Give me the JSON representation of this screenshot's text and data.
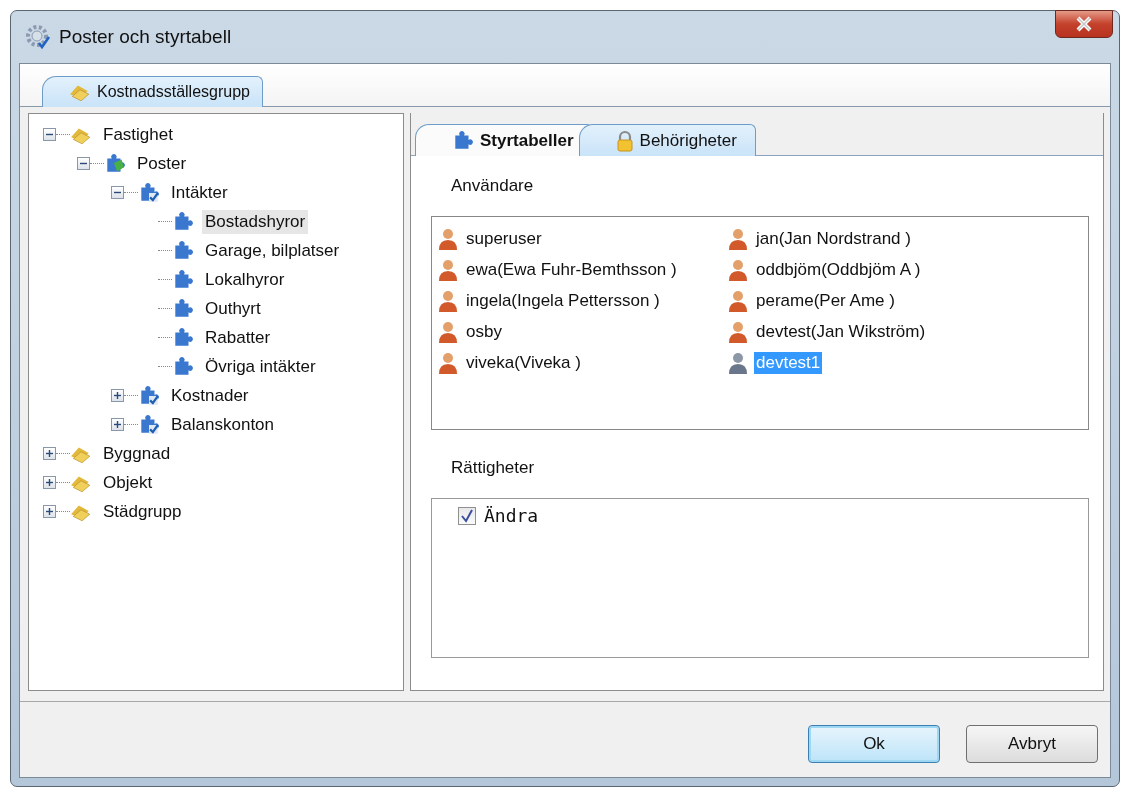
{
  "window": {
    "title": "Poster och styrtabell"
  },
  "outer_tabs": [
    {
      "label": "Kostnadsställesgrupp",
      "selected": true
    }
  ],
  "tree": [
    {
      "label": "Fastighet",
      "kind": "group",
      "expanded": true,
      "selected": false,
      "children": [
        {
          "label": "Poster",
          "kind": "puzzle-green",
          "expanded": true,
          "selected": false,
          "children": [
            {
              "label": "Intäkter",
              "kind": "puzzle-check",
              "expanded": true,
              "selected": false,
              "children": [
                {
                  "label": "Bostadshyror",
                  "kind": "puzzle",
                  "selected": true
                },
                {
                  "label": "Garage, bilplatser",
                  "kind": "puzzle",
                  "selected": false
                },
                {
                  "label": "Lokalhyror",
                  "kind": "puzzle",
                  "selected": false
                },
                {
                  "label": "Outhyrt",
                  "kind": "puzzle",
                  "selected": false
                },
                {
                  "label": "Rabatter",
                  "kind": "puzzle",
                  "selected": false
                },
                {
                  "label": "Övriga intäkter",
                  "kind": "puzzle",
                  "selected": false
                }
              ]
            },
            {
              "label": "Kostnader",
              "kind": "puzzle-check",
              "expanded": false,
              "selected": false
            },
            {
              "label": "Balanskonton",
              "kind": "puzzle-check",
              "expanded": false,
              "selected": false
            }
          ]
        }
      ]
    },
    {
      "label": "Byggnad",
      "kind": "group",
      "expanded": false,
      "selected": false
    },
    {
      "label": "Objekt",
      "kind": "group",
      "expanded": false,
      "selected": false
    },
    {
      "label": "Städgrupp",
      "kind": "group",
      "expanded": false,
      "selected": false
    }
  ],
  "inner_tabs": [
    {
      "label": "Styrtabeller",
      "kind": "puzzle",
      "emphasized": true,
      "selected": false
    },
    {
      "label": "Behörigheter",
      "kind": "lock",
      "emphasized": false,
      "selected": true
    }
  ],
  "users_label": "Användare",
  "users": [
    {
      "name": "superuser",
      "kind": "active",
      "selected": false
    },
    {
      "name": "ewa(Ewa Fuhr-Bemthsson )",
      "kind": "active",
      "selected": false
    },
    {
      "name": "ingela(Ingela Pettersson )",
      "kind": "active",
      "selected": false
    },
    {
      "name": "osby",
      "kind": "active",
      "selected": false
    },
    {
      "name": "viveka(Viveka )",
      "kind": "active",
      "selected": false
    },
    {
      "name": "jan(Jan Nordstrand )",
      "kind": "active",
      "selected": false
    },
    {
      "name": "oddbjöm(Oddbjöm A )",
      "kind": "active",
      "selected": false
    },
    {
      "name": "perame(Per Ame )",
      "kind": "active",
      "selected": false
    },
    {
      "name": "devtest(Jan Wikström)",
      "kind": "active",
      "selected": false
    },
    {
      "name": "devtest1",
      "kind": "inactive",
      "selected": true
    }
  ],
  "rights_label": "Rättigheter",
  "rights": [
    {
      "label": "Ändra",
      "checked": true
    }
  ],
  "buttons": [
    {
      "label": "Ok",
      "default": true
    },
    {
      "label": "Avbryt",
      "default": false
    }
  ]
}
